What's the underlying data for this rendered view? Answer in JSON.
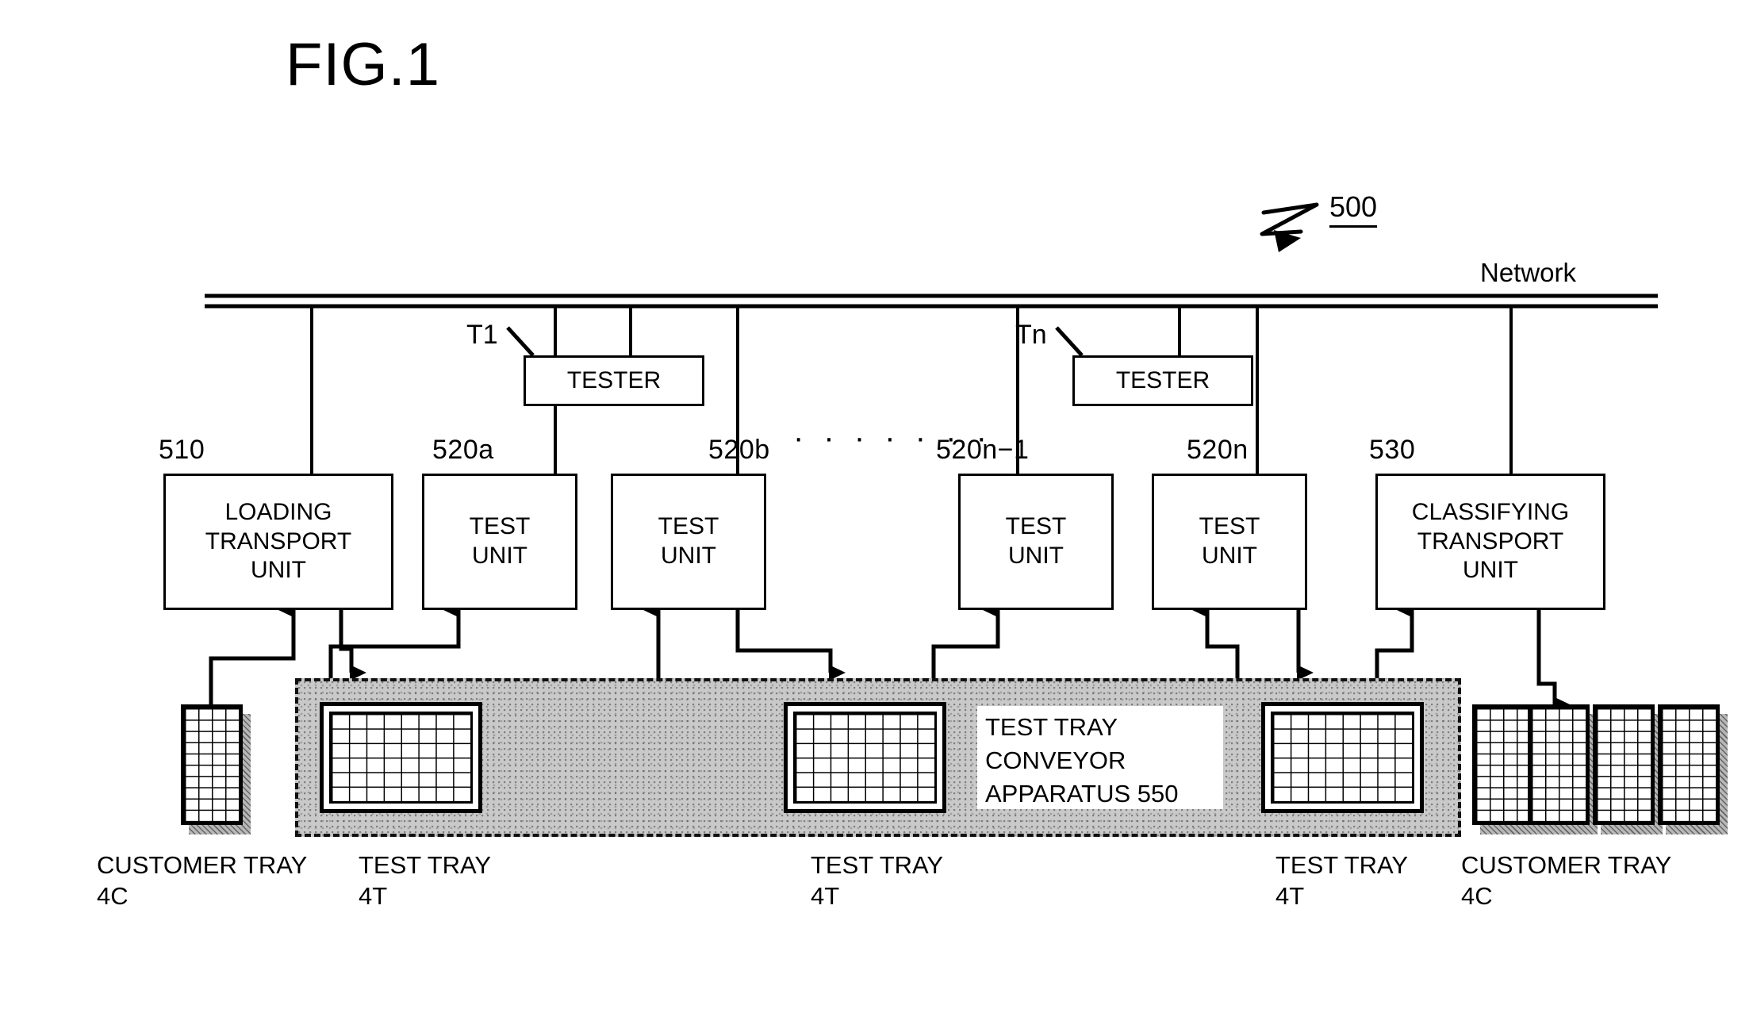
{
  "figure": {
    "title": "FIG.1",
    "system_ref": "500",
    "network_label": "Network"
  },
  "testers": [
    {
      "tag": "T1",
      "label": "TESTER"
    },
    {
      "tag": "Tn",
      "label": "TESTER"
    }
  ],
  "ellipsis": "· · · · · · ·",
  "units": [
    {
      "ref": "510",
      "lines": [
        "LOADING",
        "TRANSPORT",
        "UNIT"
      ]
    },
    {
      "ref": "520a",
      "lines": [
        "TEST",
        "UNIT"
      ]
    },
    {
      "ref": "520b",
      "lines": [
        "TEST",
        "UNIT"
      ]
    },
    {
      "ref": "520n−1",
      "lines": [
        "TEST",
        "UNIT"
      ]
    },
    {
      "ref": "520n",
      "lines": [
        "TEST",
        "UNIT"
      ]
    },
    {
      "ref": "530",
      "lines": [
        "CLASSIFYING",
        "TRANSPORT",
        "UNIT"
      ]
    }
  ],
  "conveyor": {
    "lines": [
      "TEST TRAY",
      "CONVEYOR",
      "APPARATUS 550"
    ]
  },
  "trays": {
    "customer": {
      "name": "CUSTOMER TRAY",
      "code": "4C"
    },
    "test": {
      "name": "TEST TRAY",
      "code": "4T"
    }
  },
  "bottom_captions": [
    {
      "name": "CUSTOMER TRAY",
      "code": "4C"
    },
    {
      "name": "TEST TRAY",
      "code": "4T"
    },
    {
      "name": "TEST TRAY",
      "code": "4T"
    },
    {
      "name": "TEST TRAY",
      "code": "4T"
    },
    {
      "name": "CUSTOMER TRAY",
      "code": "4C"
    }
  ],
  "colors": {
    "line": "#000000",
    "conveyor_fill": "#c9c9c9",
    "background": "#ffffff"
  }
}
